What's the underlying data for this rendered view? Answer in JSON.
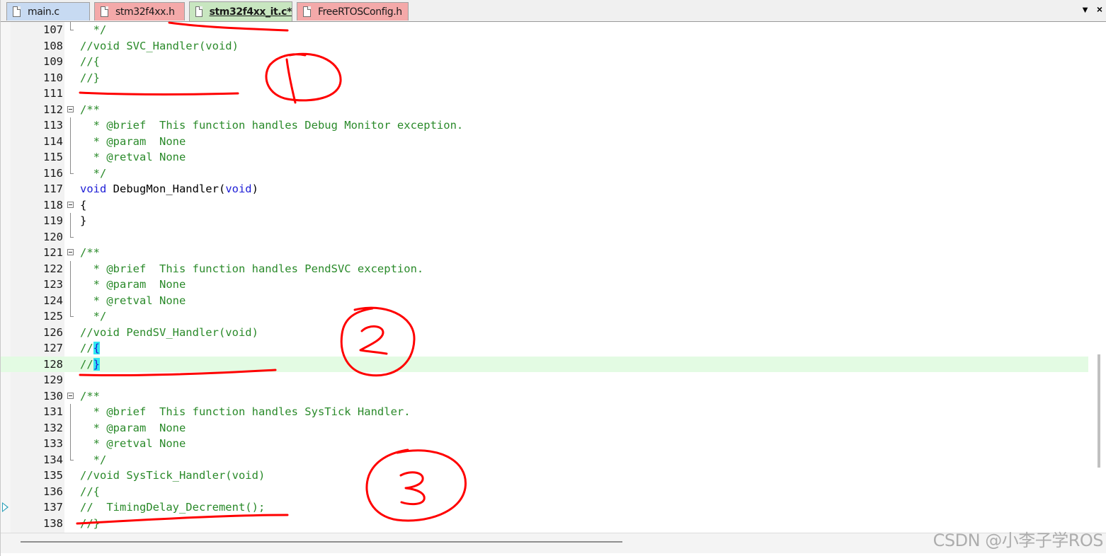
{
  "tabs": [
    {
      "label": "main.c",
      "color": "blue"
    },
    {
      "label": "stm32f4xx.h",
      "color": "pink"
    },
    {
      "label": "stm32f4xx_it.c*",
      "color": "green",
      "active": true
    },
    {
      "label": "FreeRTOSConfig.h",
      "color": "pink"
    }
  ],
  "tabbar": {
    "dropdown_icon": "chevron-down-icon",
    "close_icon": "close-icon",
    "dropdown_glyph": "▼",
    "close_glyph": "×"
  },
  "lines": [
    {
      "num": "107",
      "fold": "end",
      "parts": [
        {
          "t": "  */",
          "c": "comment"
        }
      ]
    },
    {
      "num": "108",
      "fold": "",
      "parts": [
        {
          "t": "//void SVC_Handler(void)",
          "c": "comment"
        }
      ]
    },
    {
      "num": "109",
      "fold": "",
      "parts": [
        {
          "t": "//{",
          "c": "comment"
        }
      ]
    },
    {
      "num": "110",
      "fold": "",
      "parts": [
        {
          "t": "//}",
          "c": "comment"
        }
      ]
    },
    {
      "num": "111",
      "fold": "",
      "parts": []
    },
    {
      "num": "112",
      "fold": "box",
      "parts": [
        {
          "t": "/**",
          "c": "comment"
        }
      ]
    },
    {
      "num": "113",
      "fold": "vline",
      "parts": [
        {
          "t": "  * @brief  This function handles Debug Monitor exception.",
          "c": "comment"
        }
      ]
    },
    {
      "num": "114",
      "fold": "vline",
      "parts": [
        {
          "t": "  * @param  None",
          "c": "comment"
        }
      ]
    },
    {
      "num": "115",
      "fold": "vline",
      "parts": [
        {
          "t": "  * @retval None",
          "c": "comment"
        }
      ]
    },
    {
      "num": "116",
      "fold": "end",
      "parts": [
        {
          "t": "  */",
          "c": "comment"
        }
      ]
    },
    {
      "num": "117",
      "fold": "",
      "parts": [
        {
          "t": "void",
          "c": "kw"
        },
        {
          "t": " DebugMon_Handler(",
          "c": "plain"
        },
        {
          "t": "void",
          "c": "kw"
        },
        {
          "t": ")",
          "c": "plain"
        }
      ]
    },
    {
      "num": "118",
      "fold": "box",
      "parts": [
        {
          "t": "{",
          "c": "plain"
        }
      ]
    },
    {
      "num": "119",
      "fold": "vline",
      "parts": [
        {
          "t": "}",
          "c": "plain"
        }
      ]
    },
    {
      "num": "120",
      "fold": "end",
      "parts": []
    },
    {
      "num": "121",
      "fold": "box",
      "parts": [
        {
          "t": "/**",
          "c": "comment"
        }
      ]
    },
    {
      "num": "122",
      "fold": "vline",
      "parts": [
        {
          "t": "  * @brief  This function handles PendSVC exception.",
          "c": "comment"
        }
      ]
    },
    {
      "num": "123",
      "fold": "vline",
      "parts": [
        {
          "t": "  * @param  None",
          "c": "comment"
        }
      ]
    },
    {
      "num": "124",
      "fold": "vline",
      "parts": [
        {
          "t": "  * @retval None",
          "c": "comment"
        }
      ]
    },
    {
      "num": "125",
      "fold": "end",
      "parts": [
        {
          "t": "  */",
          "c": "comment"
        }
      ]
    },
    {
      "num": "126",
      "fold": "",
      "parts": [
        {
          "t": "//void PendSV_Handler(void)",
          "c": "comment"
        }
      ]
    },
    {
      "num": "127",
      "fold": "",
      "parts": [
        {
          "t": "//",
          "c": "comment"
        },
        {
          "t": "{",
          "c": "brace"
        }
      ]
    },
    {
      "num": "128",
      "fold": "",
      "current": true,
      "parts": [
        {
          "t": "//",
          "c": "comment"
        },
        {
          "t": "}",
          "c": "brace"
        }
      ]
    },
    {
      "num": "129",
      "fold": "",
      "parts": []
    },
    {
      "num": "130",
      "fold": "box",
      "parts": [
        {
          "t": "/**",
          "c": "comment"
        }
      ]
    },
    {
      "num": "131",
      "fold": "vline",
      "parts": [
        {
          "t": "  * @brief  This function handles SysTick Handler.",
          "c": "comment"
        }
      ]
    },
    {
      "num": "132",
      "fold": "vline",
      "parts": [
        {
          "t": "  * @param  None",
          "c": "comment"
        }
      ]
    },
    {
      "num": "133",
      "fold": "vline",
      "parts": [
        {
          "t": "  * @retval None",
          "c": "comment"
        }
      ]
    },
    {
      "num": "134",
      "fold": "end",
      "parts": [
        {
          "t": "  */",
          "c": "comment"
        }
      ]
    },
    {
      "num": "135",
      "fold": "",
      "parts": [
        {
          "t": "//void SysTick_Handler(void)",
          "c": "comment"
        }
      ]
    },
    {
      "num": "136",
      "fold": "",
      "parts": [
        {
          "t": "//{",
          "c": "comment"
        }
      ]
    },
    {
      "num": "137",
      "fold": "",
      "exec": true,
      "parts": [
        {
          "t": "//  TimingDelay_Decrement();",
          "c": "comment"
        }
      ]
    },
    {
      "num": "138",
      "fold": "",
      "parts": [
        {
          "t": "//}",
          "c": "comment"
        }
      ]
    }
  ],
  "watermark": "CSDN @小李子学ROS",
  "colors": {
    "comment": "#2a8a2a",
    "keyword": "#1d1dd6",
    "current_line": "#e3fbe3",
    "brace_highlight": "#2fe6f0",
    "annotation": "#ff0000"
  }
}
